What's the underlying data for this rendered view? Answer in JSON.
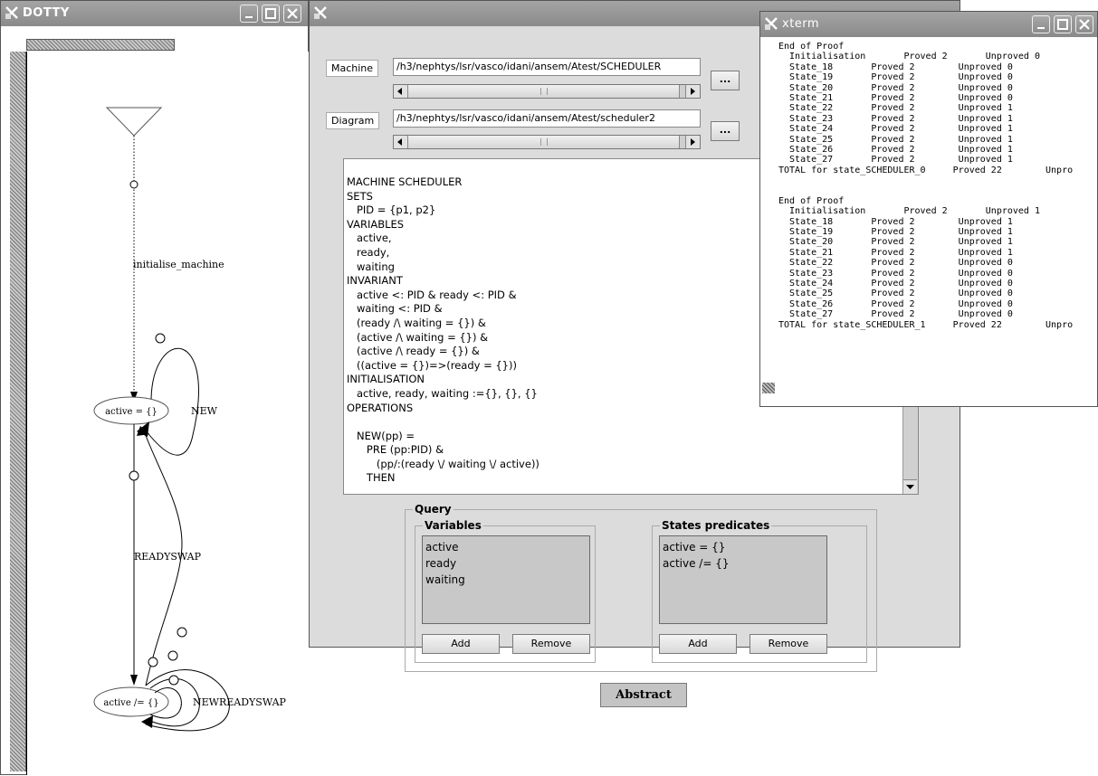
{
  "dotty": {
    "title": "DOTTY",
    "nodes": {
      "active_empty": "active = {}",
      "active_nonempty": "active /= {}"
    },
    "edge_labels": {
      "init": "initialise_machine",
      "new1": "NEW",
      "readyswap": "READYSWAP",
      "newreadyswap": "NEWREADYSWAP"
    }
  },
  "tool": {
    "title": "",
    "machine_label": "Machine",
    "machine_path": "/h3/nephtys/lsr/vasco/idani/ansem/Atest/SCHEDULER",
    "diagram_label": "Diagram",
    "diagram_path": "/h3/nephtys/lsr/vasco/idani/ansem/Atest/scheduler2",
    "browse_label": "...",
    "code_lines": [
      "MACHINE SCHEDULER",
      "SETS",
      "   PID = {p1, p2}",
      "VARIABLES",
      "   active,",
      "   ready,",
      "   waiting",
      "INVARIANT",
      "   active <: PID & ready <: PID &",
      "   waiting <: PID &",
      "   (ready /\\ waiting = {}) &",
      "   (active /\\ waiting = {}) &",
      "   (active /\\ ready = {}) &",
      "   ((active = {})=>(ready = {}))",
      "INITIALISATION",
      "   active, ready, waiting :={}, {}, {}",
      "OPERATIONS",
      "",
      "   NEW(pp) =",
      "      PRE (pp:PID) &",
      "         (pp/:(ready \\/ waiting \\/ active))",
      "      THEN"
    ],
    "query_title": "Query",
    "variables_title": "Variables",
    "variables": [
      "active",
      "ready",
      "waiting"
    ],
    "states_title": "States predicates",
    "states": [
      "active = {}",
      "active /= {}"
    ],
    "add_label": "Add",
    "remove_label": "Remove",
    "abstract_label": "Abstract"
  },
  "xterm": {
    "title": "xterm",
    "lines": [
      "End of Proof",
      "  Initialisation       Proved 2       Unproved 0",
      "  State_18       Proved 2        Unproved 0",
      "  State_19       Proved 2        Unproved 0",
      "  State_20       Proved 2        Unproved 0",
      "  State_21       Proved 2        Unproved 0",
      "  State_22       Proved 2        Unproved 1",
      "  State_23       Proved 2        Unproved 1",
      "  State_24       Proved 2        Unproved 1",
      "  State_25       Proved 2        Unproved 1",
      "  State_26       Proved 2        Unproved 1",
      "  State_27       Proved 2        Unproved 1",
      "TOTAL for state_SCHEDULER_0     Proved 22        Unpro",
      "",
      "",
      "End of Proof",
      "  Initialisation       Proved 2       Unproved 1",
      "  State_18       Proved 2        Unproved 1",
      "  State_19       Proved 2        Unproved 1",
      "  State_20       Proved 2        Unproved 1",
      "  State_21       Proved 2        Unproved 1",
      "  State_22       Proved 2        Unproved 0",
      "  State_23       Proved 2        Unproved 0",
      "  State_24       Proved 2        Unproved 0",
      "  State_25       Proved 2        Unproved 0",
      "  State_26       Proved 2        Unproved 0",
      "  State_27       Proved 2        Unproved 0",
      "TOTAL for state_SCHEDULER_1     Proved 22        Unpro"
    ]
  }
}
